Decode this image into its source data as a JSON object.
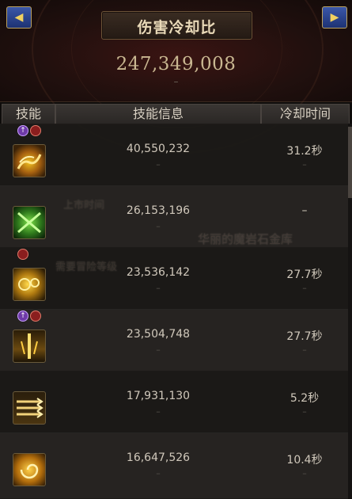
{
  "header": {
    "title": "伤害冷却比",
    "total": "247,349,008",
    "total_sub": "–",
    "prev_arrow": "◀",
    "next_arrow": "▶"
  },
  "columns": {
    "skill": "技能",
    "info": "技能信息",
    "cooldown": "冷却时间"
  },
  "rows": [
    {
      "damage": "40,550,232",
      "damage_sub": "–",
      "cooldown": "31.2秒",
      "cooldown_sub": "–",
      "icon": "flame-burst-icon",
      "badges": [
        "up",
        "cool"
      ]
    },
    {
      "damage": "26,153,196",
      "damage_sub": "–",
      "cooldown": "–",
      "cooldown_sub": "",
      "icon": "green-slash-icon",
      "badges": []
    },
    {
      "damage": "23,536,142",
      "damage_sub": "–",
      "cooldown": "27.7秒",
      "cooldown_sub": "–",
      "icon": "golden-orbs-icon",
      "badges": [
        "cool"
      ]
    },
    {
      "damage": "23,504,748",
      "damage_sub": "–",
      "cooldown": "27.7秒",
      "cooldown_sub": "–",
      "icon": "lightning-pillar-icon",
      "badges": [
        "up",
        "cool"
      ]
    },
    {
      "damage": "17,931,130",
      "damage_sub": "–",
      "cooldown": "5.2秒",
      "cooldown_sub": "–",
      "icon": "triple-arrow-icon",
      "badges": []
    },
    {
      "damage": "16,647,526",
      "damage_sub": "–",
      "cooldown": "10.4秒",
      "cooldown_sub": "–",
      "icon": "golden-swirl-icon",
      "badges": []
    }
  ],
  "background_text": {
    "line1": "华丽的魔岩石金库",
    "line2": "上市时间",
    "line3": "需要冒险等级"
  },
  "colors": {
    "header_bg": "#21100e",
    "text_main": "#d0c8bb",
    "title_text": "#e9d9b8",
    "accent_gold": "#c9b791"
  }
}
